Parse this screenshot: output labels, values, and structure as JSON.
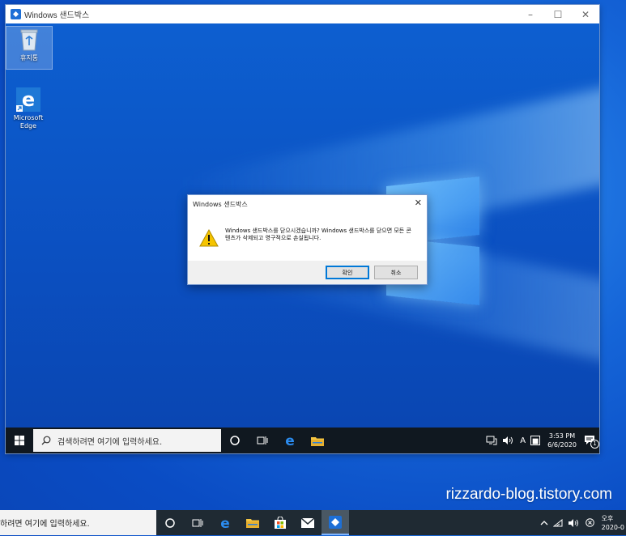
{
  "sandbox": {
    "title": "Windows 샌드박스",
    "controls": {
      "minimize": "–",
      "maximize": "☐",
      "close": "✕"
    }
  },
  "desktop_icons": [
    {
      "label": "휴지통",
      "icon": "recycle-bin-icon"
    },
    {
      "label": "Microsoft Edge",
      "icon": "edge-icon"
    }
  ],
  "dialog": {
    "title": "Windows 샌드박스",
    "close": "✕",
    "message": "Windows 샌드박스를 닫으시겠습니까? Windows 샌드박스를 닫으면 모든 콘텐츠가 삭제되고 영구적으로 손실됩니다.",
    "ok_label": "확인",
    "cancel_label": "취소"
  },
  "inner_taskbar": {
    "search_placeholder": "검색하려면 여기에 입력하세요.",
    "ime": "A",
    "time": "3:53 PM",
    "date": "6/6/2020",
    "notification_count": "1"
  },
  "watermark": "rizzardo-blog.tistory.com",
  "host_taskbar": {
    "search_placeholder": "하려면 여기에 입력하세요.",
    "clock_line1": "오후",
    "clock_line2": "2020-0"
  },
  "colors": {
    "accent": "#0078d7",
    "taskbar": "#101820",
    "host_taskbar": "#1f2a33"
  }
}
